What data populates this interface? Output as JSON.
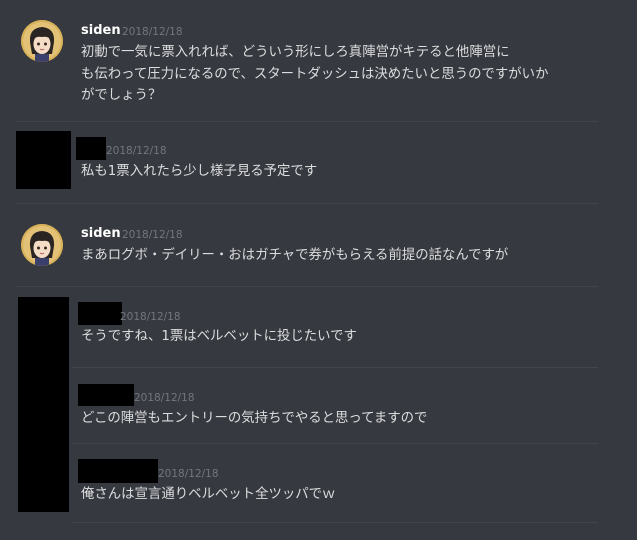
{
  "colors": {
    "background": "#36393f",
    "divider": "#42454b",
    "username": "#ffffff",
    "timestamp": "#72767d",
    "message_text": "#dcddde",
    "redaction": "#000000"
  },
  "messages": [
    {
      "author": "siden",
      "timestamp": "2018/12/18",
      "avatar_icon": "anime-girl-avatar-icon",
      "lines": [
        "初動で一気に票入れれば、どういう形にしろ真陣営がキテると他陣営に",
        "も伝わって圧力になるので、スタートダッシュは決めたいと思うのですがいか",
        "がでしょう？"
      ]
    },
    {
      "author": "",
      "author_redacted": true,
      "timestamp": "2018/12/18",
      "lines": [
        "私も1票入れたら少し様子見る予定です"
      ]
    },
    {
      "author": "siden",
      "timestamp": "2018/12/18",
      "avatar_icon": "anime-girl-avatar-icon",
      "lines": [
        "まあログボ・デイリー・おはガチャで券がもらえる前提の話なんですが"
      ]
    },
    {
      "author": "",
      "author_redacted": true,
      "timestamp": "2018/12/18",
      "lines": [
        "そうですね、1票はベルベットに投じたいです"
      ]
    },
    {
      "author": "",
      "author_redacted": true,
      "timestamp": "2018/12/18",
      "lines": [
        "どこの陣営もエントリーの気持ちでやると思ってますので"
      ]
    },
    {
      "author": "",
      "author_redacted": true,
      "timestamp": "2018/12/18",
      "lines": [
        "俺さんは宣言通りベルベット全ツッパでｗ"
      ]
    }
  ]
}
